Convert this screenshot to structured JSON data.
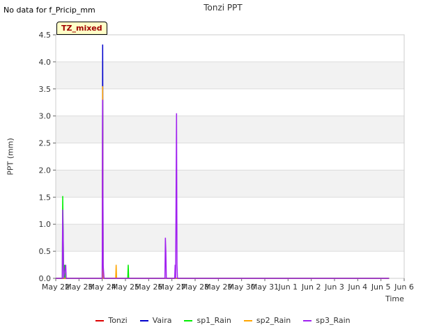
{
  "header": {
    "nodata_text": "No data for f_Pricip_mm",
    "badge": "TZ_mixed"
  },
  "chart_data": {
    "type": "line",
    "title": "Tonzi PPT",
    "xlabel": "Time",
    "ylabel": "PPT (mm)",
    "ylim": [
      0,
      4.5
    ],
    "yticks": [
      "0.0",
      "0.5",
      "1.0",
      "1.5",
      "2.0",
      "2.5",
      "3.0",
      "3.5",
      "4.0",
      "4.5"
    ],
    "xlim": [
      0,
      15
    ],
    "xtick_labels": [
      "May 22",
      "May 23",
      "May 24",
      "May 25",
      "May 26",
      "May 27",
      "May 28",
      "May 29",
      "May 30",
      "May 31",
      "Jun 1",
      "Jun 2",
      "Jun 3",
      "Jun 4",
      "Jun 5",
      "Jun 6"
    ],
    "grid": "horizontal bands",
    "legend_position": "bottom",
    "series": [
      {
        "name": "Tonzi",
        "color": "#dd0000",
        "points": [
          [
            0.0,
            0
          ],
          [
            14.35,
            0
          ]
        ]
      },
      {
        "name": "Vaira",
        "color": "#0000cc",
        "points": [
          [
            0.0,
            0
          ],
          [
            2.0,
            0
          ],
          [
            2.02,
            4.32
          ],
          [
            2.04,
            0
          ],
          [
            14.35,
            0
          ]
        ]
      },
      {
        "name": "sp1_Rain",
        "color": "#00ee00",
        "points": [
          [
            0.0,
            0
          ],
          [
            0.28,
            0
          ],
          [
            0.3,
            1.52
          ],
          [
            0.32,
            0.8
          ],
          [
            0.34,
            0
          ],
          [
            0.38,
            0.25
          ],
          [
            0.4,
            0
          ],
          [
            3.1,
            0
          ],
          [
            3.12,
            0.25
          ],
          [
            3.14,
            0
          ],
          [
            14.35,
            0
          ]
        ]
      },
      {
        "name": "sp2_Rain",
        "color": "#ffa500",
        "points": [
          [
            0.0,
            0
          ],
          [
            2.0,
            0
          ],
          [
            2.02,
            3.55
          ],
          [
            2.04,
            0
          ],
          [
            2.58,
            0
          ],
          [
            2.6,
            0.25
          ],
          [
            2.62,
            0
          ],
          [
            14.35,
            0
          ]
        ]
      },
      {
        "name": "sp3_Rain",
        "color": "#a020f0",
        "points": [
          [
            0.0,
            0
          ],
          [
            0.28,
            0
          ],
          [
            0.3,
            1.27
          ],
          [
            0.32,
            0.8
          ],
          [
            0.34,
            0
          ],
          [
            0.43,
            0.25
          ],
          [
            0.45,
            0
          ],
          [
            2.0,
            0
          ],
          [
            2.02,
            3.3
          ],
          [
            2.04,
            0.25
          ],
          [
            2.08,
            0
          ],
          [
            4.7,
            0
          ],
          [
            4.72,
            0.75
          ],
          [
            4.74,
            0.5
          ],
          [
            4.76,
            0
          ],
          [
            5.12,
            0
          ],
          [
            5.14,
            0.25
          ],
          [
            5.16,
            0
          ],
          [
            5.2,
            3.05
          ],
          [
            5.22,
            0.25
          ],
          [
            5.24,
            0
          ],
          [
            14.35,
            0
          ]
        ]
      }
    ]
  }
}
